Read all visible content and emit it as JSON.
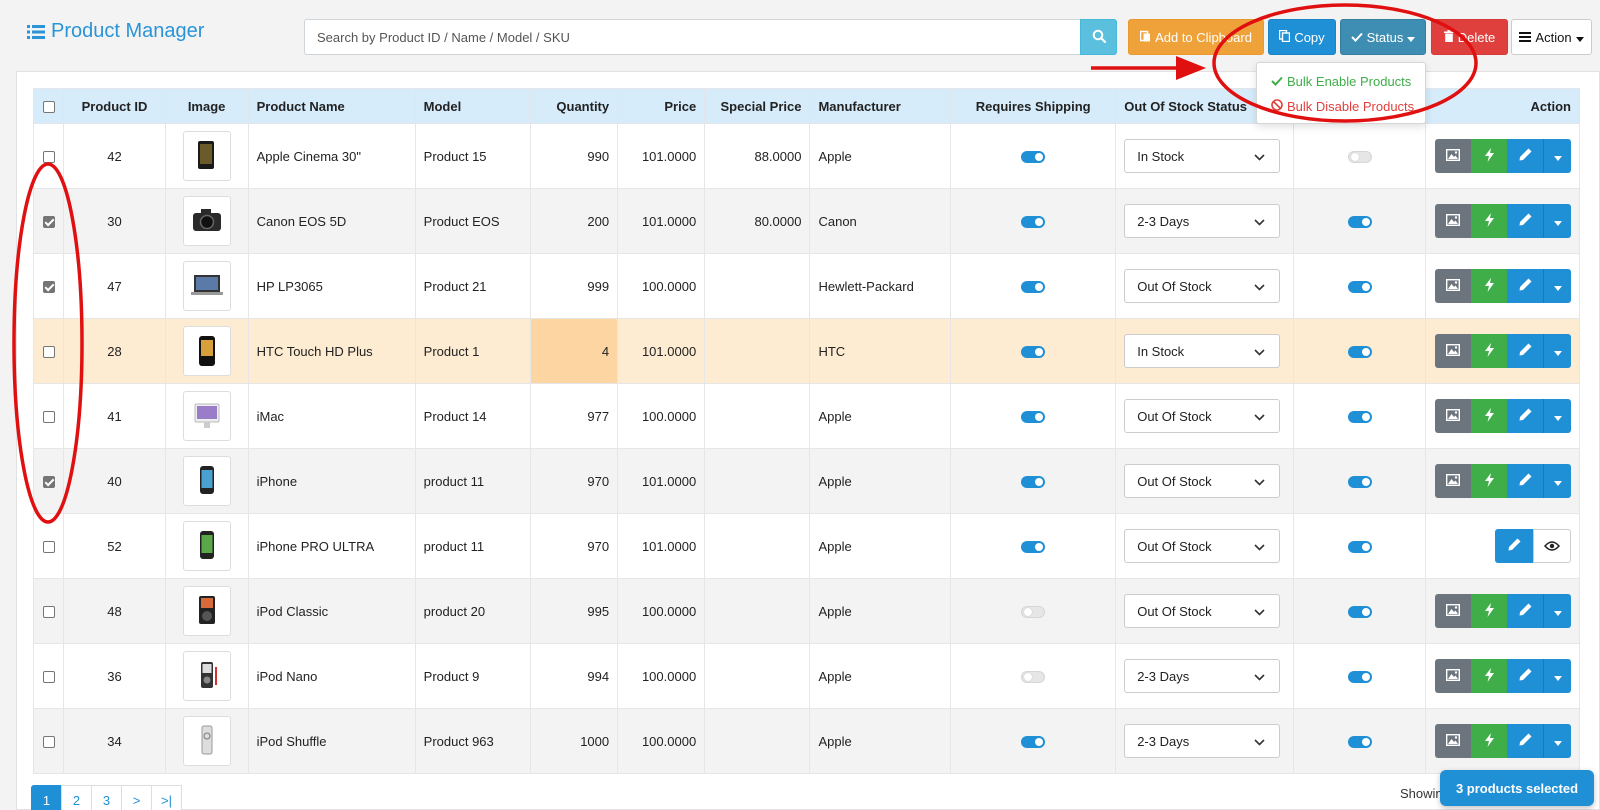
{
  "app": {
    "title": "Product Manager"
  },
  "toolbar": {
    "search_placeholder": "Search by Product ID / Name / Model / SKU",
    "add_to_clipboard": "Add to Clipboard",
    "copy": "Copy",
    "status": "Status",
    "delete": "Delete",
    "action": "Action"
  },
  "status_menu": {
    "enable": "Bulk Enable Products",
    "disable": "Bulk Disable Products"
  },
  "table": {
    "headers": {
      "product_id": "Product ID",
      "image": "Image",
      "product_name": "Product Name",
      "model": "Model",
      "quantity": "Quantity",
      "price": "Price",
      "special_price": "Special Price",
      "manufacturer": "Manufacturer",
      "requires_shipping": "Requires Shipping",
      "out_of_stock_status": "Out Of Stock Status",
      "status": "",
      "action": "Action"
    },
    "rows": [
      {
        "id": "42",
        "name": "Apple Cinema 30\"",
        "model": "Product 15",
        "quantity": "990",
        "price": "101.0000",
        "special": "88.0000",
        "manufacturer": "Apple",
        "shipping": true,
        "stock_status": "In Stock",
        "status": false,
        "checked": false
      },
      {
        "id": "30",
        "name": "Canon EOS 5D",
        "model": "Product EOS",
        "quantity": "200",
        "price": "101.0000",
        "special": "80.0000",
        "manufacturer": "Canon",
        "shipping": true,
        "stock_status": "2-3 Days",
        "status": true,
        "checked": true
      },
      {
        "id": "47",
        "name": "HP LP3065",
        "model": "Product 21",
        "quantity": "999",
        "price": "100.0000",
        "special": "",
        "manufacturer": "Hewlett-Packard",
        "shipping": true,
        "stock_status": "Out Of Stock",
        "status": true,
        "checked": true
      },
      {
        "id": "28",
        "name": "HTC Touch HD Plus",
        "model": "Product 1",
        "quantity": "4",
        "price": "101.0000",
        "special": "",
        "manufacturer": "HTC",
        "shipping": true,
        "stock_status": "In Stock",
        "status": true,
        "checked": false
      },
      {
        "id": "41",
        "name": "iMac",
        "model": "Product 14",
        "quantity": "977",
        "price": "100.0000",
        "special": "",
        "manufacturer": "Apple",
        "shipping": true,
        "stock_status": "Out Of Stock",
        "status": true,
        "checked": false
      },
      {
        "id": "40",
        "name": "iPhone",
        "model": "product 11",
        "quantity": "970",
        "price": "101.0000",
        "special": "",
        "manufacturer": "Apple",
        "shipping": true,
        "stock_status": "Out Of Stock",
        "status": true,
        "checked": true
      },
      {
        "id": "52",
        "name": "iPhone PRO ULTRA",
        "model": "product 11",
        "quantity": "970",
        "price": "101.0000",
        "special": "",
        "manufacturer": "Apple",
        "shipping": true,
        "stock_status": "Out Of Stock",
        "status": true,
        "checked": false
      },
      {
        "id": "48",
        "name": "iPod Classic",
        "model": "product 20",
        "quantity": "995",
        "price": "100.0000",
        "special": "",
        "manufacturer": "Apple",
        "shipping": false,
        "stock_status": "Out Of Stock",
        "status": true,
        "checked": false
      },
      {
        "id": "36",
        "name": "iPod Nano",
        "model": "Product 9",
        "quantity": "994",
        "price": "100.0000",
        "special": "",
        "manufacturer": "Apple",
        "shipping": false,
        "stock_status": "2-3 Days",
        "status": true,
        "checked": false
      },
      {
        "id": "34",
        "name": "iPod Shuffle",
        "model": "Product 963",
        "quantity": "1000",
        "price": "100.0000",
        "special": "",
        "manufacturer": "Apple",
        "shipping": true,
        "stock_status": "2-3 Days",
        "status": true,
        "checked": false
      }
    ]
  },
  "pagination": {
    "pages": [
      "1",
      "2",
      "3",
      ">",
      ">|"
    ],
    "active": "1"
  },
  "footer": {
    "showing": "Showin",
    "selected_badge": "3 products selected"
  },
  "colors": {
    "primary": "#1f8fd6",
    "clipboard": "#f0a23a",
    "status": "#3d8eb2",
    "danger": "#e0403d",
    "success": "#3fae49",
    "annotation": "#e01010"
  }
}
